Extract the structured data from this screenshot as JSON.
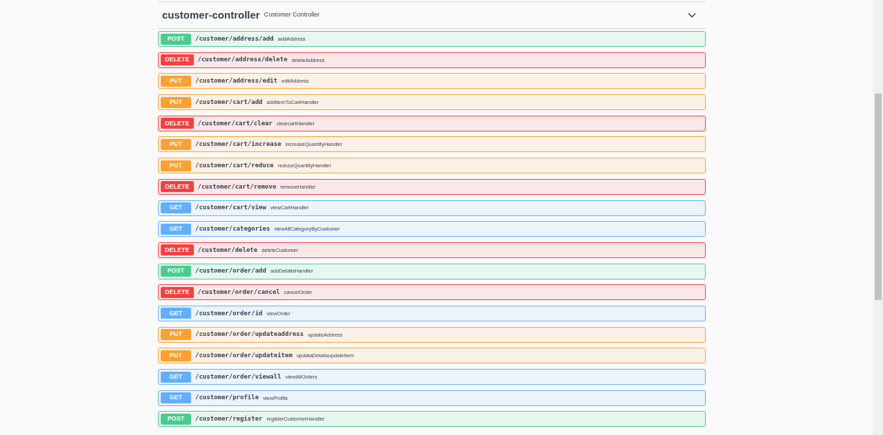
{
  "tag": {
    "name": "customer-controller",
    "description": "Customer Controller",
    "expanded": true
  },
  "operations": [
    {
      "method": "POST",
      "path": "/customer/address/add",
      "summary": "addAddress"
    },
    {
      "method": "DELETE",
      "path": "/customer/address/delete",
      "summary": "deleteAddress"
    },
    {
      "method": "PUT",
      "path": "/customer/address/edit",
      "summary": "editAddress"
    },
    {
      "method": "PUT",
      "path": "/customer/cart/add",
      "summary": "addItemToCartHandler"
    },
    {
      "method": "DELETE",
      "path": "/customer/cart/clear",
      "summary": "clearcartHandler"
    },
    {
      "method": "PUT",
      "path": "/customer/cart/increase",
      "summary": "increaseQuantityHandler"
    },
    {
      "method": "PUT",
      "path": "/customer/cart/reduce",
      "summary": "reduceQuantityHandler"
    },
    {
      "method": "DELETE",
      "path": "/customer/cart/remove",
      "summary": "removeHandler"
    },
    {
      "method": "GET",
      "path": "/customer/cart/view",
      "summary": "viewCartHandler"
    },
    {
      "method": "GET",
      "path": "/customer/categories",
      "summary": "viewAllCategoryByCustomer"
    },
    {
      "method": "DELETE",
      "path": "/customer/delete",
      "summary": "deleteCustomer"
    },
    {
      "method": "POST",
      "path": "/customer/order/add",
      "summary": "addDetailsHandler"
    },
    {
      "method": "DELETE",
      "path": "/customer/order/cancel",
      "summary": "cancelOrder"
    },
    {
      "method": "GET",
      "path": "/customer/order/id",
      "summary": "viewOrder"
    },
    {
      "method": "PUT",
      "path": "/customer/order/updateaddress",
      "summary": "updateAddress"
    },
    {
      "method": "PUT",
      "path": "/customer/order/updateitem",
      "summary": "updataDetailsupdateItem"
    },
    {
      "method": "GET",
      "path": "/customer/order/viewall",
      "summary": "viewAllOrders"
    },
    {
      "method": "GET",
      "path": "/customer/profile",
      "summary": "viewProfile"
    },
    {
      "method": "POST",
      "path": "/customer/register",
      "summary": "registerCustomerHandler"
    }
  ]
}
